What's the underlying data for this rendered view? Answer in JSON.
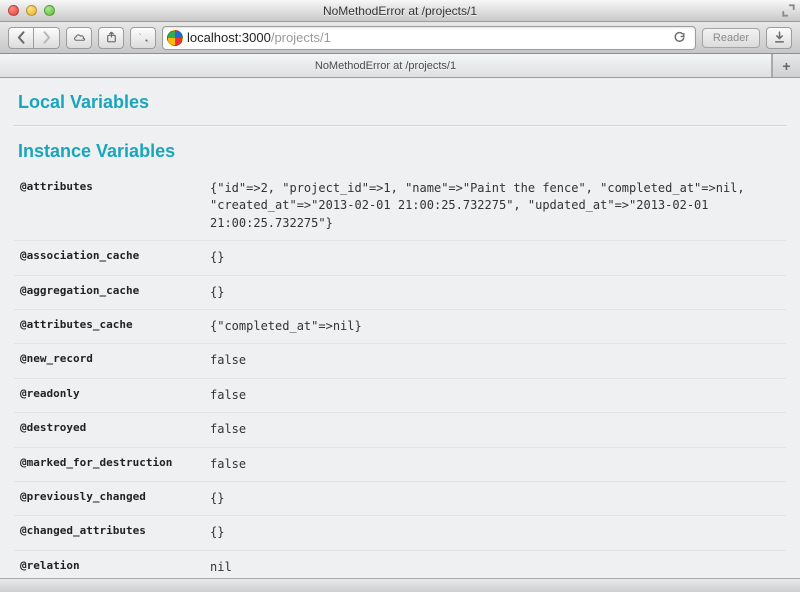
{
  "window": {
    "title": "NoMethodError at /projects/1"
  },
  "url": {
    "host": "localhost:3000",
    "path": "/projects/1"
  },
  "reader_label": "Reader",
  "tab": {
    "title": "NoMethodError at /projects/1"
  },
  "sections": {
    "local": "Local Variables",
    "instance": "Instance Variables"
  },
  "instance_vars": [
    {
      "name": "@attributes",
      "value": "{\"id\"=>2, \"project_id\"=>1, \"name\"=>\"Paint the fence\", \"completed_at\"=>nil, \"created_at\"=>\"2013-02-01 21:00:25.732275\", \"updated_at\"=>\"2013-02-01 21:00:25.732275\"}"
    },
    {
      "name": "@association_cache",
      "value": "{}"
    },
    {
      "name": "@aggregation_cache",
      "value": "{}"
    },
    {
      "name": "@attributes_cache",
      "value": "{\"completed_at\"=>nil}"
    },
    {
      "name": "@new_record",
      "value": "false"
    },
    {
      "name": "@readonly",
      "value": "false"
    },
    {
      "name": "@destroyed",
      "value": "false"
    },
    {
      "name": "@marked_for_destruction",
      "value": "false"
    },
    {
      "name": "@previously_changed",
      "value": "{}"
    },
    {
      "name": "@changed_attributes",
      "value": "{}"
    },
    {
      "name": "@relation",
      "value": "nil"
    }
  ],
  "newtab_label": "+"
}
